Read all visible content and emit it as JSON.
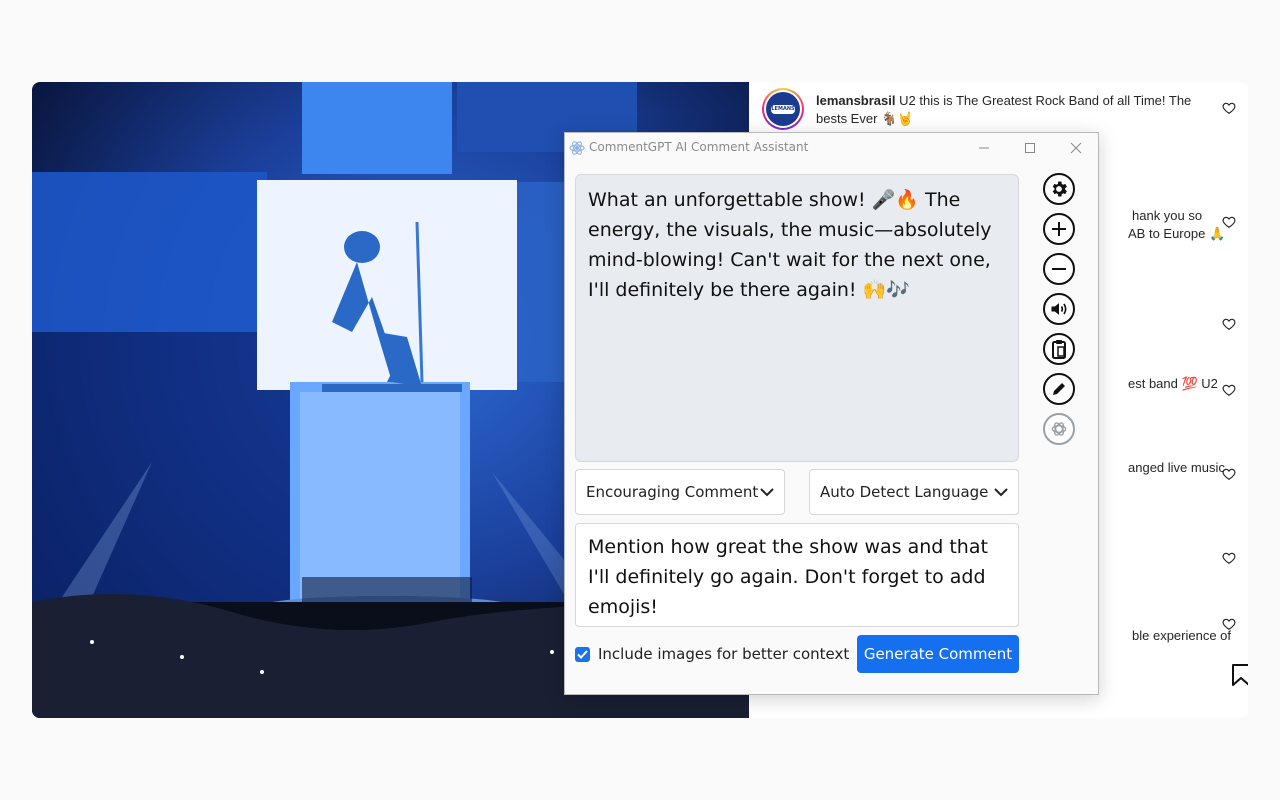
{
  "post": {
    "comments": [
      {
        "username": "lemansbrasil",
        "text": "U2 this is The Greatest Rock Band of all Time! The bests Ever 🐐🤘"
      }
    ],
    "partial_texts": [
      "hank you so",
      "AB to Europe 🙏",
      "est band 💯 U2",
      "anged live music",
      "ble experience of"
    ],
    "avatar_logo_text": "LEMANS"
  },
  "assistant": {
    "window_title": "CommentGPT AI Comment Assistant",
    "generated_comment": "What an unforgettable show! 🎤🔥 The energy, the visuals, the music—absolutely mind-blowing! Can't wait for the next one, I'll definitely be there again! 🙌🎶",
    "tone_select": "Encouraging Comment",
    "language_select": "Auto Detect Language",
    "prompt_text": "Mention how great the show was and that I'll definitely go again. Don't forget to add emojis!",
    "include_images_label": "Include images for better context",
    "include_images_checked": true,
    "generate_label": "Generate Comment",
    "side_buttons": [
      "gear-icon",
      "plus-icon",
      "minus-icon",
      "speaker-icon",
      "clipboard-icon",
      "pencil-icon",
      "openai-icon"
    ],
    "accent_color": "#1570ef"
  }
}
